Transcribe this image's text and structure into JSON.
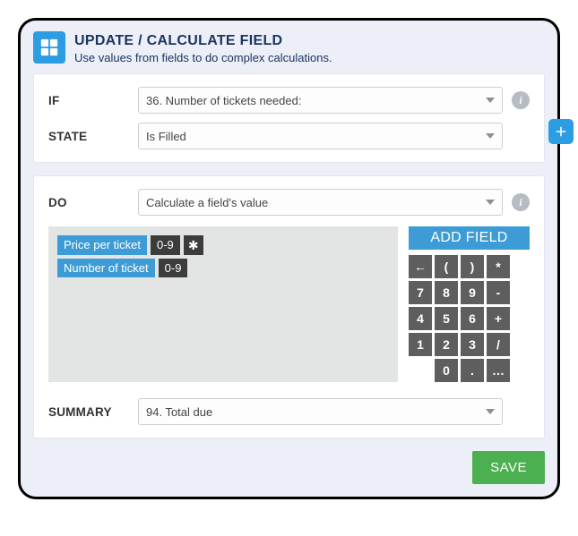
{
  "header": {
    "title": "UPDATE / CALCULATE FIELD",
    "subtitle": "Use values from fields to do complex calculations."
  },
  "condition": {
    "if_label": "IF",
    "if_value": "36. Number of tickets needed:",
    "state_label": "STATE",
    "state_value": "Is Filled"
  },
  "action": {
    "do_label": "DO",
    "do_value": "Calculate a field's value",
    "tokens": [
      {
        "field": "Price per ticket",
        "type": "0-9",
        "op": "*"
      },
      {
        "field": "Number of ticket",
        "type": "0-9"
      }
    ],
    "add_field_label": "ADD FIELD",
    "keypad": [
      "←",
      "(",
      ")",
      "*",
      "7",
      "8",
      "9",
      "-",
      "4",
      "5",
      "6",
      "+",
      "1",
      "2",
      "3",
      "/",
      "",
      "0",
      ".",
      "…"
    ],
    "summary_label": "SUMMARY",
    "summary_value": "94. Total due"
  },
  "footer": {
    "save_label": "SAVE"
  }
}
